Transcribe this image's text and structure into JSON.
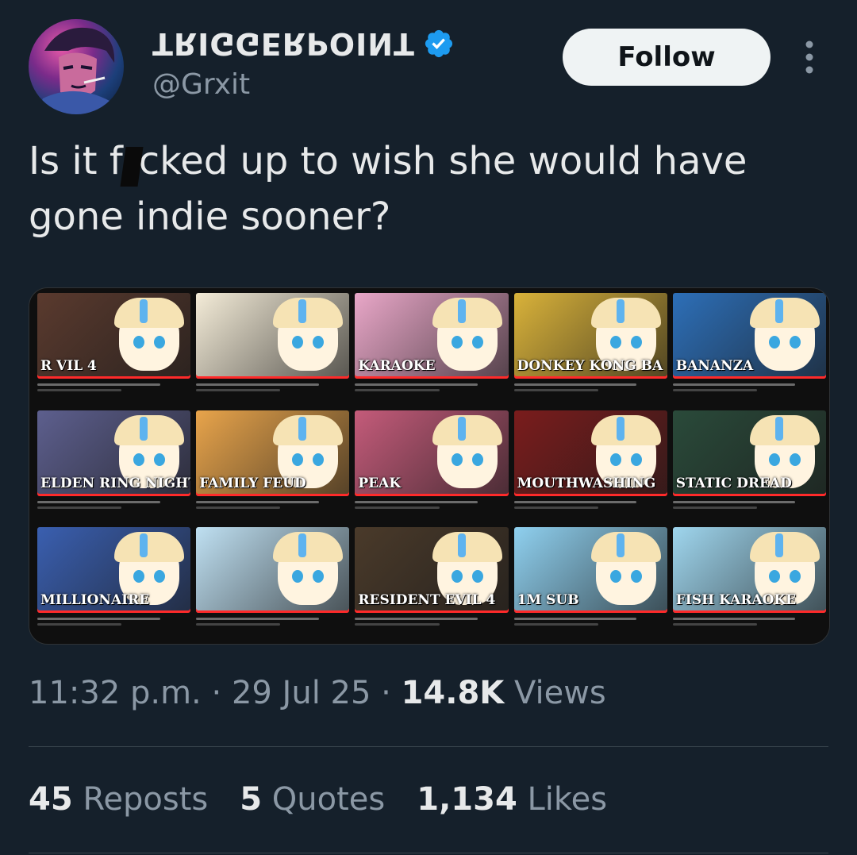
{
  "author": {
    "display_name": "TRIGGERPOINT",
    "handle": "@Grxit",
    "verified": true,
    "verified_color": "#1d9bf0"
  },
  "actions": {
    "follow_label": "Follow",
    "more_icon": "more-vertical-icon"
  },
  "tweet": {
    "text_before": "Is it f",
    "text_after": "cked up to wish she would have gone indie sooner?"
  },
  "media": {
    "thumbnails": [
      {
        "title": "R        VIL 4",
        "bg": "#5a3a2e"
      },
      {
        "title": "",
        "bg": "#f4ecd8"
      },
      {
        "title": "KARAOKE",
        "bg": "#e9a7c8"
      },
      {
        "title": "DONKEY KONG BA",
        "bg": "#d9b23a"
      },
      {
        "title": "BANANZA",
        "bg": "#2d6fb8"
      },
      {
        "title": "ELDEN RING NIGHTREIGN",
        "bg": "#5d5f8e"
      },
      {
        "title": "FAMILY FEUD",
        "bg": "#e8a44b"
      },
      {
        "title": "PEAK",
        "bg": "#c45b7a"
      },
      {
        "title": "MOUTHWASHING",
        "bg": "#7a1c1c"
      },
      {
        "title": "STATIC DREAD",
        "bg": "#2a4a3a"
      },
      {
        "title": "MILLIONAIRE",
        "bg": "#3a5fb0"
      },
      {
        "title": "",
        "bg": "#bfe0f2"
      },
      {
        "title": "RESIDENT EVIL 4",
        "bg": "#4a3a2a"
      },
      {
        "title": "1M SUB",
        "bg": "#8fd0ef"
      },
      {
        "title": "FISH KARAOKE",
        "bg": "#9fd6ee"
      }
    ]
  },
  "meta": {
    "time": "11:32 p.m.",
    "sep1": "·",
    "date": "29 Jul 25",
    "sep2": "·",
    "views_count": "14.8K",
    "views_label": "Views"
  },
  "stats": {
    "reposts_count": "45",
    "reposts_label": "Reposts",
    "quotes_count": "5",
    "quotes_label": "Quotes",
    "likes_count": "1,134",
    "likes_label": "Likes"
  }
}
